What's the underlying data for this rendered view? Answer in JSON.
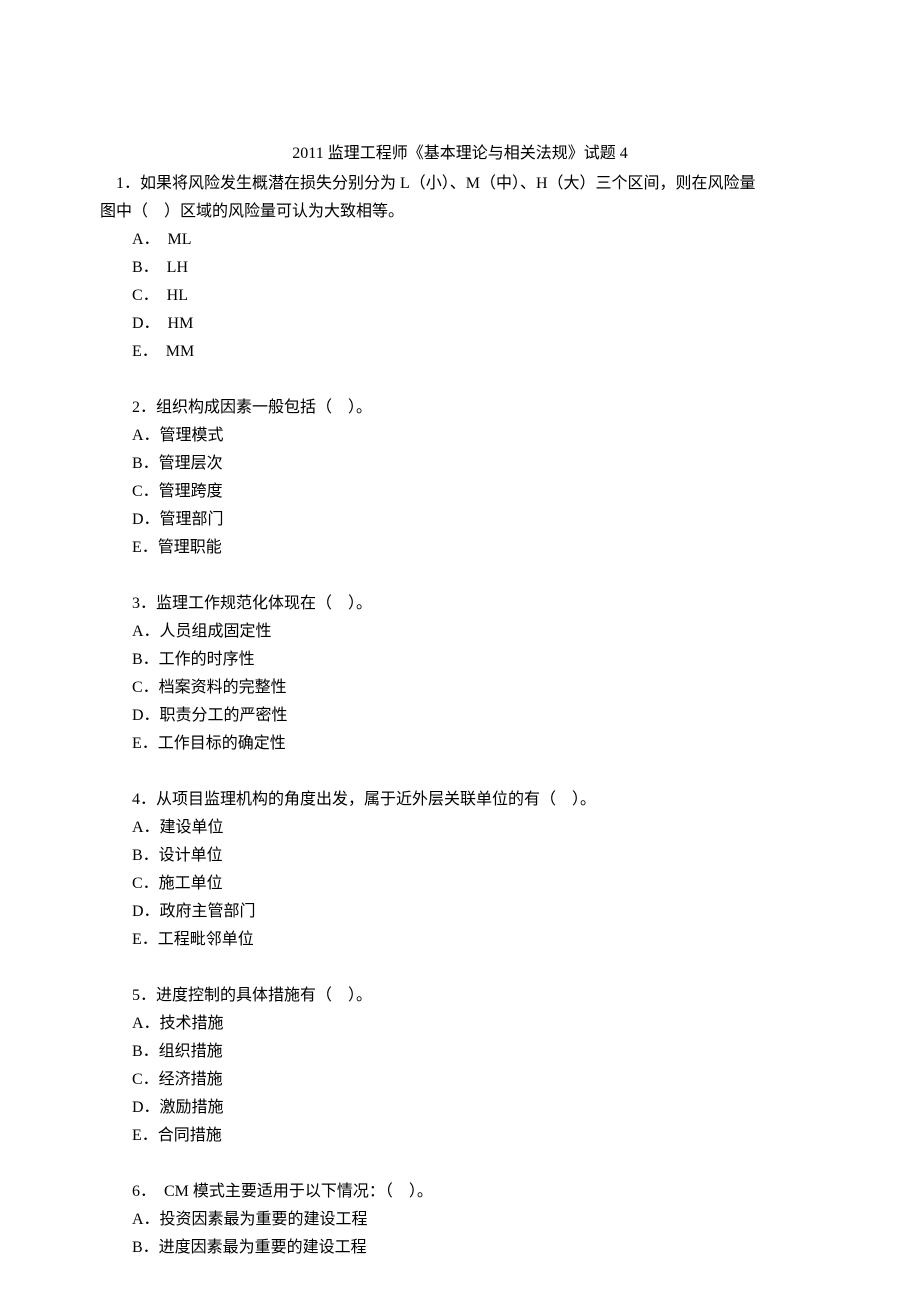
{
  "title": "2011 监理工程师《基本理论与相关法规》试题 4",
  "q1": {
    "stem_line1": "1．如果将风险发生概潜在损失分别分为 L（小）、M（中）、H（大）三个区间，则在风险量",
    "stem_line2": "图中（　）区域的风险量可认为大致相等。",
    "options": {
      "A": "A． ML",
      "B": "B． LH",
      "C": "C． HL",
      "D": "D． HM",
      "E": "E． MM"
    }
  },
  "q2": {
    "stem": "2．组织构成因素一般包括（　）。",
    "options": {
      "A": "A．管理模式",
      "B": "B．管理层次",
      "C": "C．管理跨度",
      "D": "D．管理部门",
      "E": "E．管理职能"
    }
  },
  "q3": {
    "stem": "3．监理工作规范化体现在（　）。",
    "options": {
      "A": "A．人员组成固定性",
      "B": "B．工作的时序性",
      "C": "C．档案资料的完整性",
      "D": "D．职责分工的严密性",
      "E": "E．工作目标的确定性"
    }
  },
  "q4": {
    "stem": "4．从项目监理机构的角度出发，属于近外层关联单位的有（　）。",
    "options": {
      "A": "A．建设单位",
      "B": "B．设计单位",
      "C": "C．施工单位",
      "D": "D．政府主管部门",
      "E": "E．工程毗邻单位"
    }
  },
  "q5": {
    "stem": "5．进度控制的具体措施有（　）。",
    "options": {
      "A": "A．技术措施",
      "B": "B．组织措施",
      "C": "C．经济措施",
      "D": "D．激励措施",
      "E": "E．合同措施"
    }
  },
  "q6": {
    "stem": "6． CM 模式主要适用于以下情况：（　）。",
    "options": {
      "A": "A．投资因素最为重要的建设工程",
      "B": "B．进度因素最为重要的建设工程"
    }
  }
}
